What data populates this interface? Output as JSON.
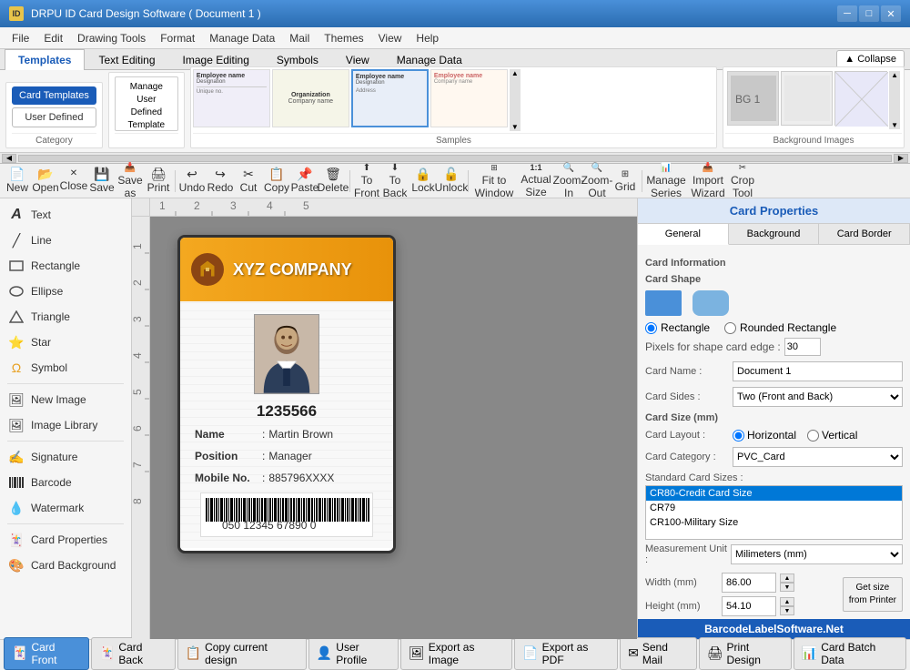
{
  "titleBar": {
    "icon": "ID",
    "title": "DRPU ID Card Design Software ( Document 1 )",
    "minBtn": "─",
    "maxBtn": "□",
    "closeBtn": "✕"
  },
  "menuBar": {
    "items": [
      "File",
      "Edit",
      "Drawing Tools",
      "Format",
      "Manage Data",
      "Mail",
      "Themes",
      "View",
      "Help"
    ]
  },
  "ribbonTabs": {
    "tabs": [
      "Templates",
      "Text Editing",
      "Image Editing",
      "Symbols",
      "View",
      "Manage Data"
    ],
    "activeTab": "Templates"
  },
  "ribbonTemplates": {
    "categoryLabel": "Category",
    "cardTemplatesBtn": "Card Templates",
    "userDefinedBtn": "User Defined",
    "manageBtn": "Manage\nUser\nDefined\nTemplate",
    "samplesLabel": "Samples",
    "bgImagesLabel": "Background Images",
    "collapseBtn": "▲ Collapse"
  },
  "toolbar": {
    "buttons": [
      {
        "name": "new",
        "icon": "📄",
        "label": "New"
      },
      {
        "name": "open",
        "icon": "📂",
        "label": "Open"
      },
      {
        "name": "close",
        "icon": "✕",
        "label": "Close"
      },
      {
        "name": "save",
        "icon": "💾",
        "label": "Save"
      },
      {
        "name": "save-as",
        "icon": "📥",
        "label": "Save as"
      },
      {
        "name": "print",
        "icon": "🖨",
        "label": "Print"
      },
      {
        "name": "undo",
        "icon": "↩",
        "label": "Undo"
      },
      {
        "name": "redo",
        "icon": "↪",
        "label": "Redo"
      },
      {
        "name": "cut",
        "icon": "✂",
        "label": "Cut"
      },
      {
        "name": "copy",
        "icon": "📋",
        "label": "Copy"
      },
      {
        "name": "paste",
        "icon": "📌",
        "label": "Paste"
      },
      {
        "name": "delete",
        "icon": "🗑",
        "label": "Delete"
      },
      {
        "name": "to-front",
        "icon": "⬆",
        "label": "To Front"
      },
      {
        "name": "to-back",
        "icon": "⬇",
        "label": "To Back"
      },
      {
        "name": "lock",
        "icon": "🔒",
        "label": "Lock"
      },
      {
        "name": "unlock",
        "icon": "🔓",
        "label": "Unlock"
      },
      {
        "name": "fit-window",
        "icon": "⊞",
        "label": "Fit to Window"
      },
      {
        "name": "actual-size",
        "icon": "1:1",
        "label": "Actual Size"
      },
      {
        "name": "zoom-in",
        "icon": "🔍+",
        "label": "Zoom-In"
      },
      {
        "name": "zoom-out",
        "icon": "🔍-",
        "label": "Zoom-Out"
      },
      {
        "name": "grid",
        "icon": "⊞",
        "label": "Grid"
      },
      {
        "name": "manage-series",
        "icon": "📊",
        "label": "Manage Series"
      },
      {
        "name": "import-wizard",
        "icon": "📥",
        "label": "Import Wizard"
      },
      {
        "name": "crop-tool",
        "icon": "✂",
        "label": "Crop Tool"
      }
    ]
  },
  "leftPanel": {
    "tools": [
      {
        "name": "text",
        "icon": "A",
        "label": "Text"
      },
      {
        "name": "line",
        "icon": "╱",
        "label": "Line"
      },
      {
        "name": "rectangle",
        "icon": "▭",
        "label": "Rectangle"
      },
      {
        "name": "ellipse",
        "icon": "⬭",
        "label": "Ellipse"
      },
      {
        "name": "triangle",
        "icon": "△",
        "label": "Triangle"
      },
      {
        "name": "star",
        "icon": "⭐",
        "label": "Star"
      },
      {
        "name": "symbol",
        "icon": "Ω",
        "label": "Symbol"
      },
      {
        "divider": true
      },
      {
        "name": "new-image",
        "icon": "🖼",
        "label": "New Image"
      },
      {
        "name": "image-library",
        "icon": "🖼",
        "label": "Image Library"
      },
      {
        "divider": true
      },
      {
        "name": "signature",
        "icon": "✍",
        "label": "Signature"
      },
      {
        "name": "barcode",
        "icon": "⫠",
        "label": "Barcode"
      },
      {
        "name": "watermark",
        "icon": "💧",
        "label": "Watermark"
      },
      {
        "divider": true
      },
      {
        "name": "card-properties",
        "icon": "🃏",
        "label": "Card Properties"
      },
      {
        "name": "card-background",
        "icon": "🎨",
        "label": "Card Background"
      }
    ]
  },
  "idCard": {
    "company": "XYZ COMPANY",
    "employeeId": "1235566",
    "name": "Martin Brown",
    "position": "Manager",
    "mobile": "885796XXXX",
    "nameLabel": "Name",
    "positionLabel": "Position",
    "mobileLabel": "Mobile No.",
    "barcodeText": "050 12345 67890 0"
  },
  "cardProperties": {
    "title": "Card Properties",
    "tabs": [
      "General",
      "Background",
      "Card Border"
    ],
    "activeTab": "General",
    "sections": {
      "cardInfo": "Card Information",
      "cardShape": "Card Shape"
    },
    "shapes": {
      "rectangle": "Rectangle",
      "roundedRectangle": "Rounded Rectangle",
      "pixelsLabel": "Pixels for shape card edge :",
      "pixelsValue": "30"
    },
    "cardNameLabel": "Card Name :",
    "cardNameValue": "Document 1",
    "cardSidesLabel": "Card Sides :",
    "cardSidesValue": "Two (Front and Back)",
    "cardSizeLabel": "Card Size (mm)",
    "cardLayoutLabel": "Card Layout :",
    "cardLayoutHorizontal": "Horizontal",
    "cardLayoutVertical": "Vertical",
    "cardCategoryLabel": "Card Category :",
    "cardCategoryValue": "PVC_Card",
    "standardSizesLabel": "Standard Card Sizes :",
    "standardSizes": [
      "CR80-Credit Card Size",
      "CR79",
      "CR100-Military Size"
    ],
    "selectedSize": "CR80-Credit Card Size",
    "measurementLabel": "Measurement Unit :",
    "measurementValue": "Milimeters (mm)",
    "widthLabel": "Width  (mm)",
    "widthValue": "86.00",
    "heightLabel": "Height (mm)",
    "heightValue": "54.10",
    "getSizeBtn": "Get size\nfrom Printer"
  },
  "statusBar": {
    "tabs": [
      {
        "name": "card-front",
        "icon": "🃏",
        "label": "Card Front",
        "active": true
      },
      {
        "name": "card-back",
        "icon": "🃏",
        "label": "Card Back"
      },
      {
        "name": "copy-design",
        "icon": "📋",
        "label": "Copy current design"
      },
      {
        "name": "user-profile",
        "icon": "👤",
        "label": "User Profile"
      },
      {
        "name": "export-image",
        "icon": "🖼",
        "label": "Export as Image"
      },
      {
        "name": "export-pdf",
        "icon": "📄",
        "label": "Export as PDF"
      },
      {
        "name": "send-mail",
        "icon": "✉",
        "label": "Send Mail"
      },
      {
        "name": "print-design",
        "icon": "🖨",
        "label": "Print Design"
      },
      {
        "name": "card-batch",
        "icon": "📊",
        "label": "Card Batch Data"
      }
    ],
    "watermark": "BarcodeLabelSoftware.Net"
  }
}
